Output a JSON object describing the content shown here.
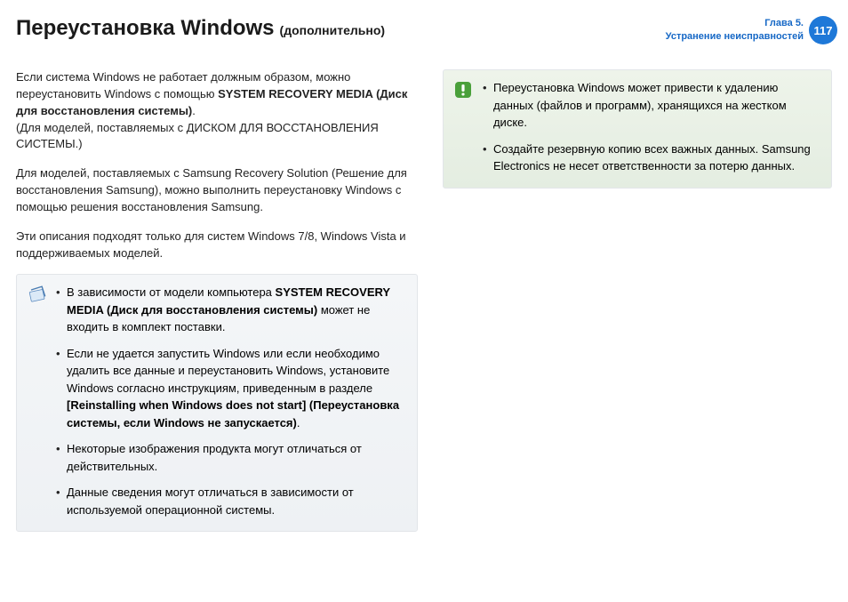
{
  "header": {
    "title": "Переустановка Windows",
    "subtitle": "(дополнительно)",
    "chapter_line1": "Глава 5.",
    "chapter_line2": "Устранение неисправностей",
    "page_number": "117"
  },
  "left": {
    "p1_a": "Если система Windows не работает должным образом, можно переустановить Windows с помощью ",
    "p1_b": "SYSTEM RECOVERY MEDIA (Диск для восстановления системы)",
    "p1_c": ".",
    "p1_d": "(Для моделей, поставляемых с ДИСКОМ ДЛЯ ВОССТАНОВЛЕНИЯ СИСТЕМЫ.)",
    "p2": "Для моделей, поставляемых с Samsung Recovery Solution (Решение для восстановления Samsung), можно выполнить переустановку Windows с помощью решения восстановления Samsung.",
    "p3": "Эти описания подходят только для систем Windows 7/8, Windows Vista и поддерживаемых моделей.",
    "note": {
      "b1_a": "В зависимости от модели компьютера ",
      "b1_b": "SYSTEM RECOVERY MEDIA (Диск для восстановления системы)",
      "b1_c": " может не входить в комплект поставки.",
      "b2_a": "Если не удается запустить Windows или если необходимо удалить все данные и переустановить Windows, установите Windows согласно инструкциям, приведенным в разделе ",
      "b2_b": "[Reinstalling when Windows does not start] (Переустановка системы, если Windows не запускается)",
      "b2_c": ".",
      "b3": "Некоторые изображения продукта могут отличаться от действительных.",
      "b4": "Данные сведения могут отличаться в зависимости от используемой операционной системы."
    }
  },
  "right": {
    "alert": {
      "b1": "Переустановка Windows может привести к удалению данных (файлов и программ), хранящихся на жестком диске.",
      "b2": "Создайте резервную копию всех важных данных. Samsung Electronics не несет ответственности за потерю данных."
    }
  }
}
